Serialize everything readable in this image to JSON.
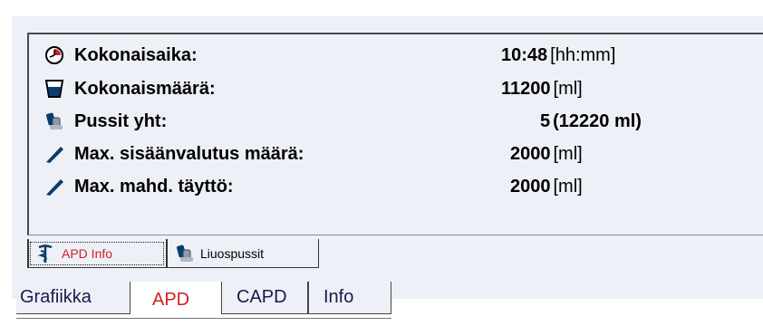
{
  "rows": [
    {
      "icon": "clock-icon",
      "label": "Kokonaisaika:",
      "value": "10:48",
      "unit": "[hh:mm]",
      "unit_bold": false
    },
    {
      "icon": "cup-icon",
      "label": "Kokonaismäärä:",
      "value": "11200",
      "unit": "[ml]",
      "unit_bold": false
    },
    {
      "icon": "bags-icon",
      "label": "Pussit yht:",
      "value": "5",
      "unit": "(12220 ml)",
      "unit_bold": true
    },
    {
      "icon": "slope-icon",
      "label": "Max. sisäänvalutus määrä:",
      "value": "2000",
      "unit": "[ml]",
      "unit_bold": false
    },
    {
      "icon": "slope-icon",
      "label": "Max. mahd. täyttö:",
      "value": "2000",
      "unit": "[ml]",
      "unit_bold": false
    }
  ],
  "subtabs": [
    {
      "label": "APD Info",
      "icon": "caduceus-icon",
      "active": true
    },
    {
      "label": "Liuospussit",
      "icon": "bags-icon",
      "active": false
    }
  ],
  "maintabs": [
    {
      "label": "Grafiikka",
      "active": false
    },
    {
      "label": "APD",
      "active": true
    },
    {
      "label": "CAPD",
      "active": false
    },
    {
      "label": "Info",
      "active": false
    }
  ],
  "colors": {
    "accent": "#d02020",
    "panel": "#eef0f8",
    "icon_blue": "#0a3d6b"
  }
}
